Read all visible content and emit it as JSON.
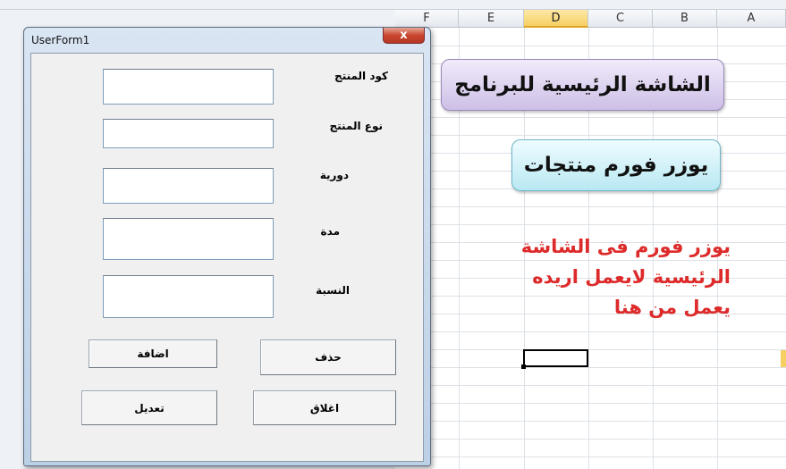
{
  "sheet": {
    "columns": [
      {
        "label": "F",
        "active": false
      },
      {
        "label": "E",
        "active": false
      },
      {
        "label": "D",
        "active": true
      },
      {
        "label": "C",
        "active": false
      },
      {
        "label": "B",
        "active": false
      },
      {
        "label": "A",
        "active": false
      }
    ],
    "shapes": {
      "main_screen": "الشاشة الرئيسية للبرنامج",
      "userform_products": "يوزر فورم منتجات"
    },
    "note_lines": [
      "يوزر فورم فى الشاشة",
      "الرئيسية لايعمل اريده",
      "يعمل من هنا"
    ],
    "colors": {
      "note_text": "#dd2a2a",
      "main_shape_fill": "#cdbfe6",
      "form_shape_fill": "#b9e8f2",
      "active_column": "#f6cf62"
    }
  },
  "userform": {
    "title": "UserForm1",
    "close_icon": "close-x-icon",
    "close_glyph": "x",
    "labels": {
      "product_code": "كود المنتج",
      "product_type": "نوع المنتج",
      "periodicity": "دورية",
      "duration": "مدة",
      "percentage": "النسبة"
    },
    "fields": {
      "product_code": "",
      "product_type": "",
      "periodicity": "",
      "duration": "",
      "percentage": ""
    },
    "buttons": {
      "add": "اضافة",
      "delete": "حذف",
      "edit": "تعديل",
      "close": "اغلاق"
    }
  }
}
